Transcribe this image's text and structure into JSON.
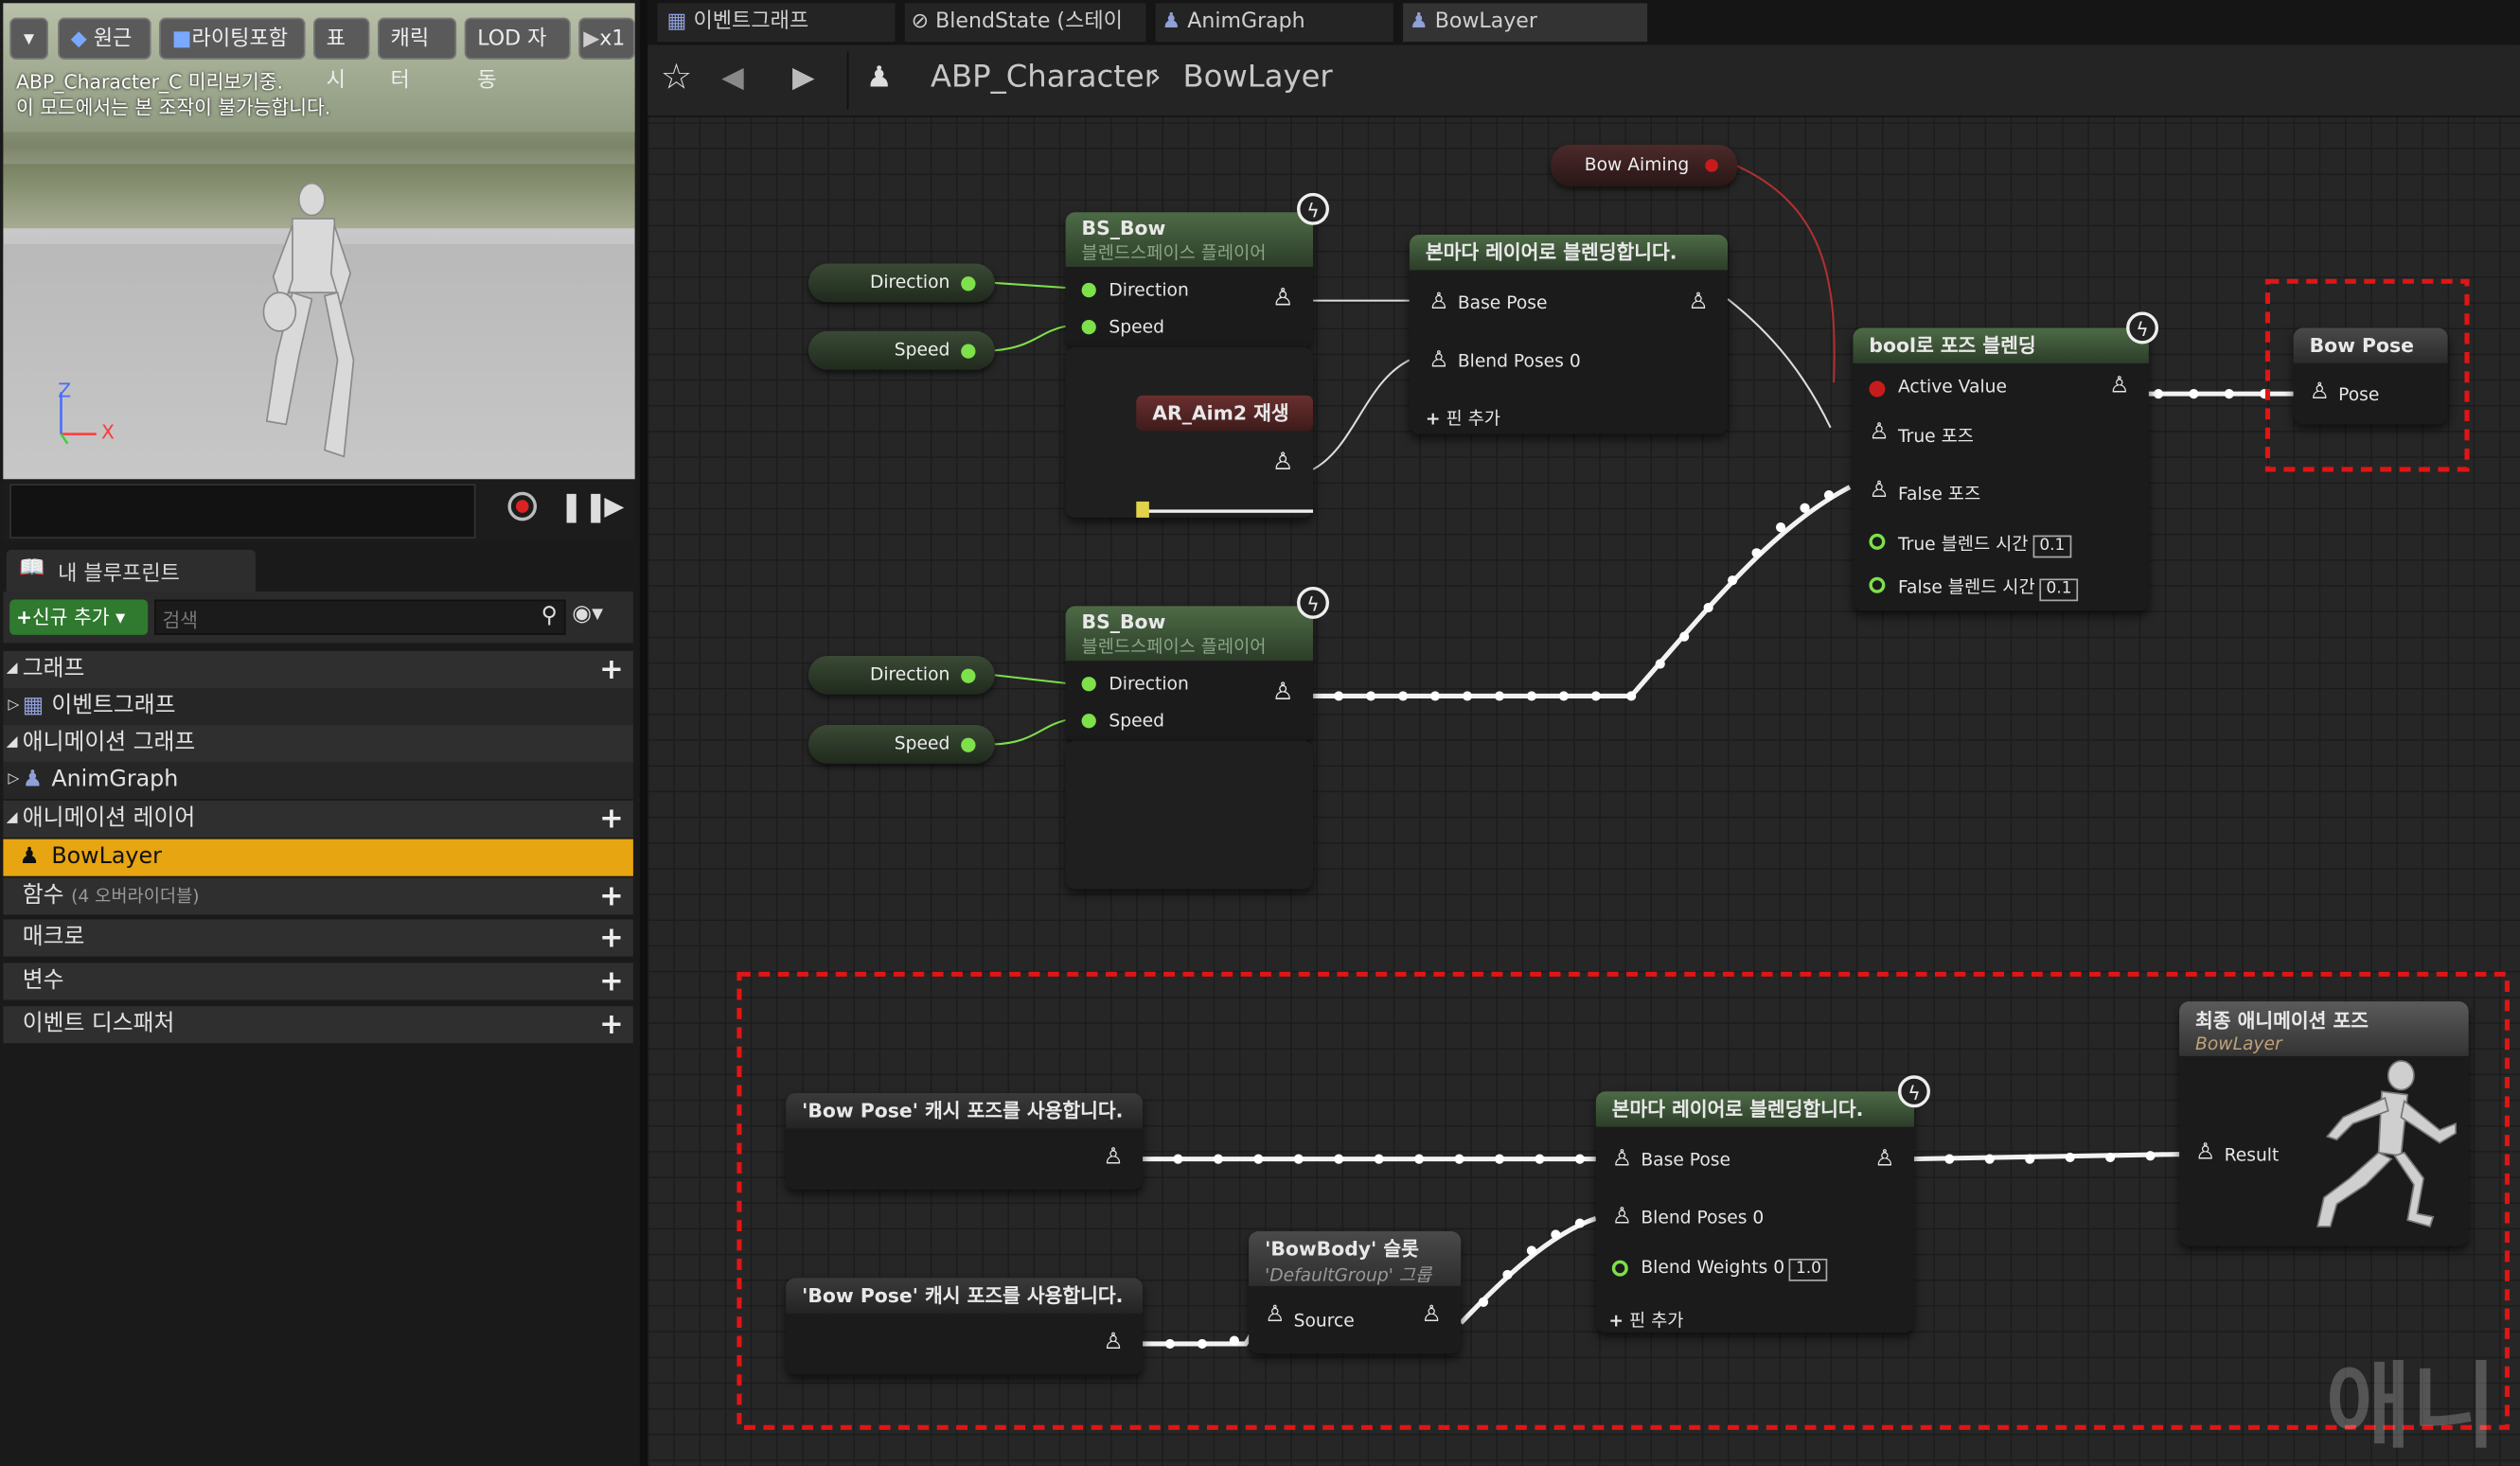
{
  "viewport": {
    "buttons": [
      "원근",
      "라이팅포함",
      "표시",
      "캐릭터",
      "LOD 자동",
      "x1"
    ],
    "info_line1": "ABP_Character_C 미리보기중.",
    "info_line2": "이 모드에서는 본 조작이 불가능합니다.",
    "axis_z": "Z",
    "axis_x": "X"
  },
  "my_blueprint": {
    "tab_label": "내 블루프린트",
    "add_new": "신규 추가",
    "search_placeholder": "검색",
    "sections": {
      "graph": "그래프",
      "event_graph": "이벤트그래프",
      "anim_graph_header": "애니메이션 그래프",
      "anim_graph": "AnimGraph",
      "anim_layers": "애니메이션 레이어",
      "bow_layer": "BowLayer",
      "functions": "함수",
      "functions_note": "(4 오버라이더블)",
      "macros": "매크로",
      "variables": "변수",
      "event_dispatchers": "이벤트 디스패처"
    }
  },
  "tabs": [
    "이벤트그래프",
    "BlendState (스테이",
    "AnimGraph",
    "BowLayer"
  ],
  "breadcrumb": {
    "root": "ABP_Character",
    "current": "BowLayer"
  },
  "nodes": {
    "bow_aiming": "Bow Aiming",
    "bs_bow_1": {
      "title": "BS_Bow",
      "subtitle": "블렌드스페이스 플레이어",
      "pin1": "Direction",
      "pin2": "Speed"
    },
    "var_direction": "Direction",
    "var_speed": "Speed",
    "ar_aim2": "AR_Aim2 재생",
    "layered_blend_1": {
      "title": "본마다 레이어로 블렌딩합니다.",
      "pin1": "Base Pose",
      "pin2": "Blend Poses 0",
      "add": "핀 추가"
    },
    "bool_blend": {
      "title": "bool로 포즈 블렌딩",
      "pin1": "Active Value",
      "pin2": "True 포즈",
      "pin3": "False 포즈",
      "pin4": "True 블렌드 시간",
      "val4": "0.1",
      "pin5": "False 블렌드 시간",
      "val5": "0.1"
    },
    "bow_pose_save": {
      "title": "Bow Pose",
      "pin": "Pose"
    },
    "bs_bow_2": {
      "title": "BS_Bow",
      "subtitle": "블렌드스페이스 플레이어",
      "pin1": "Direction",
      "pin2": "Speed"
    },
    "use_cache_1": "'Bow Pose' 캐시 포즈를 사용합니다.",
    "use_cache_2": "'Bow Pose' 캐시 포즈를 사용합니다.",
    "slot": {
      "title": "'BowBody' 슬롯",
      "subtitle": "'DefaultGroup' 그룹",
      "pin": "Source"
    },
    "layered_blend_2": {
      "title": "본마다 레이어로 블렌딩합니다.",
      "pin1": "Base Pose",
      "pin2": "Blend Poses 0",
      "pin3": "Blend Weights 0",
      "val3": "1.0",
      "add": "핀 추가"
    },
    "final_pose": {
      "title": "최종 애니메이션 포즈",
      "subtitle": "BowLayer",
      "pin": "Result"
    }
  },
  "watermark": "애니"
}
